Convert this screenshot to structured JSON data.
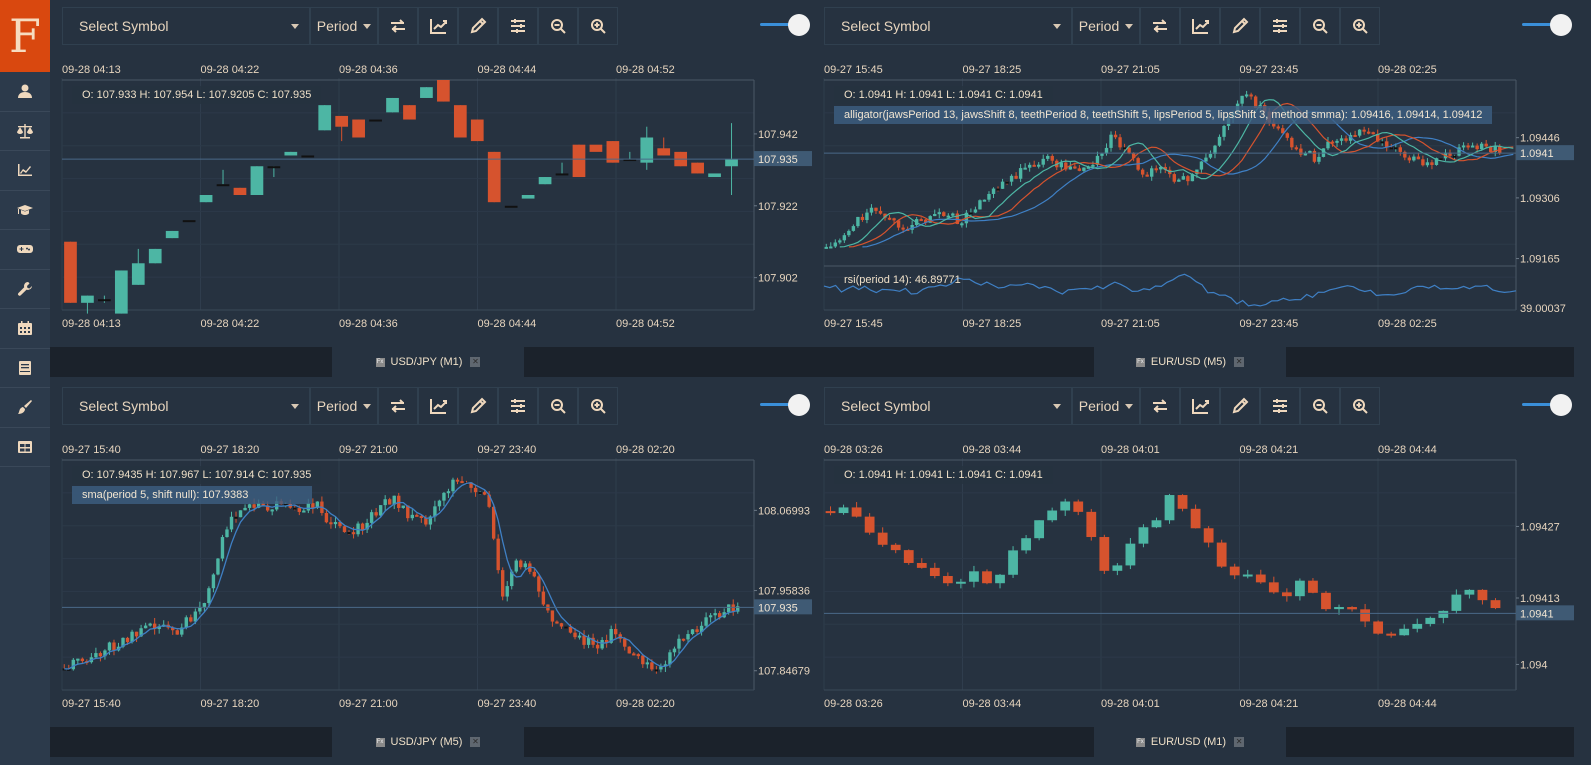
{
  "app": {
    "logo_letter": "F"
  },
  "sidebar": {
    "items": [
      {
        "name": "account",
        "icon": "user-icon"
      },
      {
        "name": "balance",
        "icon": "scale-icon"
      },
      {
        "name": "charts",
        "icon": "chart-line-icon"
      },
      {
        "name": "education",
        "icon": "graduation-cap-icon"
      },
      {
        "name": "games",
        "icon": "gamepad-icon"
      },
      {
        "name": "tools",
        "icon": "wrench-icon"
      },
      {
        "name": "calendar",
        "icon": "calendar-icon"
      },
      {
        "name": "book",
        "icon": "book-icon"
      },
      {
        "name": "themes",
        "icon": "paint-brush-icon"
      },
      {
        "name": "layout",
        "icon": "table-icon"
      }
    ]
  },
  "toolbar": {
    "symbol_placeholder": "Select Symbol",
    "period_label": "Period",
    "icons": [
      "swap-icon",
      "indicator-chart-icon",
      "pencil-icon",
      "settings-sliders-icon",
      "zoom-out-icon",
      "zoom-in-icon"
    ]
  },
  "colors": {
    "up": "#4db6a4",
    "down": "#d6532e",
    "sma": "#3f80c5",
    "jaws": "#3f80c5",
    "teeth": "#d6532e",
    "lips": "#4db6a4",
    "rsi": "#3f80c5",
    "accent": "#3a8fd9",
    "logo_bg": "#d9480f"
  },
  "panels": [
    {
      "tab": "USD/JPY (M1)",
      "ohlc": "O: 107.933 H: 107.954 L: 107.9205 C: 107.935",
      "indicator": null,
      "rsi": null,
      "current_price": "107.935",
      "time_labels": [
        "09-28 04:13",
        "09-28 04:22",
        "09-28 04:36",
        "09-28 04:44",
        "09-28 04:52"
      ],
      "price_labels": [
        "107.942",
        "107.922",
        "107.902"
      ],
      "chart_data": {
        "type": "candlestick",
        "symbol": "USD/JPY",
        "period": "M1",
        "x_ticks": [
          "09-28 04:13",
          "09-28 04:22",
          "09-28 04:36",
          "09-28 04:44",
          "09-28 04:52"
        ],
        "y_ticks": [
          107.942,
          107.922,
          107.902
        ],
        "ylim": [
          107.893,
          107.957
        ],
        "last_close": 107.935,
        "candles": [
          [
            107.912,
            107.912,
            107.895,
            107.895
          ],
          [
            107.895,
            107.897,
            107.892,
            107.897
          ],
          [
            107.896,
            107.897,
            107.895,
            107.896
          ],
          [
            107.892,
            107.904,
            107.892,
            107.904
          ],
          [
            107.9,
            107.91,
            107.9,
            107.906
          ],
          [
            107.906,
            107.91,
            107.906,
            107.91
          ],
          [
            107.913,
            107.915,
            107.913,
            107.915
          ],
          [
            107.918,
            107.918,
            107.918,
            107.918
          ],
          [
            107.923,
            107.925,
            107.923,
            107.925
          ],
          [
            107.928,
            107.932,
            107.928,
            107.928
          ],
          [
            107.927,
            107.927,
            107.925,
            107.925
          ],
          [
            107.925,
            107.933,
            107.925,
            107.933
          ],
          [
            107.933,
            107.933,
            107.93,
            107.933
          ],
          [
            107.936,
            107.937,
            107.936,
            107.937
          ],
          [
            107.936,
            107.936,
            107.936,
            107.936
          ],
          [
            107.943,
            107.95,
            107.943,
            107.95
          ],
          [
            107.947,
            107.947,
            107.94,
            107.944
          ],
          [
            107.946,
            107.946,
            107.941,
            107.941
          ],
          [
            107.946,
            107.946,
            107.946,
            107.946
          ],
          [
            107.948,
            107.952,
            107.948,
            107.952
          ],
          [
            107.95,
            107.95,
            107.946,
            107.946
          ],
          [
            107.952,
            107.955,
            107.952,
            107.955
          ],
          [
            107.957,
            107.957,
            107.951,
            107.951
          ],
          [
            107.95,
            107.95,
            107.941,
            107.941
          ],
          [
            107.946,
            107.946,
            107.94,
            107.94
          ],
          [
            107.937,
            107.937,
            107.923,
            107.923
          ],
          [
            107.922,
            107.922,
            107.922,
            107.922
          ],
          [
            107.924,
            107.924,
            107.924,
            107.925
          ],
          [
            107.928,
            107.93,
            107.928,
            107.93
          ],
          [
            107.931,
            107.934,
            107.931,
            107.931
          ],
          [
            107.939,
            107.939,
            107.93,
            107.93
          ],
          [
            107.939,
            107.937,
            107.937,
            107.937
          ],
          [
            107.94,
            107.94,
            107.934,
            107.934
          ],
          [
            107.935,
            107.937,
            107.935,
            107.935
          ],
          [
            107.934,
            107.944,
            107.932,
            107.941
          ],
          [
            107.938,
            107.941,
            107.936,
            107.936
          ],
          [
            107.937,
            107.937,
            107.933,
            107.933
          ],
          [
            107.934,
            107.934,
            107.931,
            107.931
          ],
          [
            107.93,
            107.93,
            107.93,
            107.931
          ],
          [
            107.933,
            107.945,
            107.925,
            107.935
          ]
        ]
      }
    },
    {
      "tab": "EUR/USD (M5)",
      "ohlc": "O: 1.0941 H: 1.0941 L: 1.0941 C: 1.0941",
      "indicator": "alligator(jawsPeriod 13, jawsShift 8, teethPeriod 8, teethShift 5, lipsPeriod 5, lipsShift 3, method smma): 1.09416, 1.09414, 1.09412",
      "rsi": "rsi(period 14): 46.89771",
      "rsi_axis_label": "39.00037",
      "current_price": "1.0941",
      "time_labels": [
        "09-27 15:45",
        "09-27 18:25",
        "09-27 21:05",
        "09-27 23:45",
        "09-28 02:25"
      ],
      "price_labels": [
        "1.09446",
        "1.09306",
        "1.09165"
      ],
      "chart_data": {
        "type": "candlestick",
        "symbol": "EUR/USD",
        "period": "M5",
        "x_ticks": [
          "09-27 15:45",
          "09-27 18:25",
          "09-27 21:05",
          "09-27 23:45",
          "09-28 02:25"
        ],
        "y_ticks": [
          1.09446,
          1.09306,
          1.09165
        ],
        "ylim": [
          1.0915,
          1.0958
        ],
        "last_close": 1.0941,
        "indicators": [
          {
            "name": "alligator",
            "params": "jawsPeriod 13, jawsShift 8, teethPeriod 8, teethShift 5, lipsPeriod 5, lipsShift 3, method smma",
            "values": [
              1.09416,
              1.09414,
              1.09412
            ]
          },
          {
            "name": "rsi",
            "params": "period 14",
            "value": 46.89771,
            "axis_label": 39.00037
          }
        ],
        "path": [
          1.0919,
          1.0921,
          1.0926,
          1.0928,
          1.0925,
          1.0924,
          1.0926,
          1.0927,
          1.0925,
          1.0929,
          1.0932,
          1.0935,
          1.0938,
          1.094,
          1.0938,
          1.0937,
          1.0939,
          1.0945,
          1.094,
          1.0936,
          1.0938,
          1.0934,
          1.0937,
          1.0942,
          1.095,
          1.0955,
          1.095,
          1.0946,
          1.0942,
          1.094,
          1.0944,
          1.0945,
          1.0946,
          1.0943,
          1.0941,
          1.0939,
          1.0939,
          1.0941,
          1.0942,
          1.0943,
          1.0941
        ],
        "rsi_path": [
          52,
          48,
          50,
          47,
          49,
          46,
          48,
          50,
          55,
          52,
          50,
          49,
          51,
          48,
          46,
          50,
          49,
          52,
          48,
          47,
          55,
          60,
          48,
          43,
          40,
          38,
          42,
          39,
          44,
          47,
          52,
          49,
          45,
          44,
          48,
          51,
          47,
          49,
          52,
          48,
          47
        ]
      }
    },
    {
      "tab": "USD/JPY (M5)",
      "ohlc": "O: 107.9435 H: 107.967 L: 107.914 C: 107.935",
      "indicator": "sma(period 5, shift null): 107.9383",
      "rsi": null,
      "current_price": "107.935",
      "time_labels": [
        "09-27 15:40",
        "09-27 18:20",
        "09-27 21:00",
        "09-27 23:40",
        "09-28 02:20"
      ],
      "price_labels": [
        "108.06993",
        "107.95836",
        "107.84679"
      ],
      "chart_data": {
        "type": "candlestick",
        "symbol": "USD/JPY",
        "period": "M5",
        "x_ticks": [
          "09-27 15:40",
          "09-27 18:20",
          "09-27 21:00",
          "09-27 23:40",
          "09-28 02:20"
        ],
        "y_ticks": [
          108.06993,
          107.95836,
          107.84679
        ],
        "ylim": [
          107.82,
          108.14
        ],
        "last_close": 107.935,
        "indicators": [
          {
            "name": "sma",
            "params": "period 5, shift null",
            "value": 107.9383
          }
        ],
        "path": [
          107.85,
          107.86,
          107.87,
          107.88,
          107.89,
          107.9,
          107.91,
          107.9,
          107.92,
          107.95,
          108.02,
          108.07,
          108.08,
          108.07,
          108.08,
          108.07,
          108.08,
          108.05,
          108.04,
          108.05,
          108.07,
          108.09,
          108.06,
          108.05,
          108.08,
          108.12,
          108.1,
          108.09,
          107.95,
          108.0,
          107.98,
          107.92,
          107.91,
          107.89,
          107.88,
          107.9,
          107.88,
          107.86,
          107.85,
          107.88,
          107.9,
          107.92,
          107.93,
          107.935
        ]
      }
    },
    {
      "tab": "EUR/USD (M1)",
      "ohlc": "O: 1.0941 H: 1.0941 L: 1.0941 C: 1.0941",
      "indicator": null,
      "rsi": null,
      "current_price": "1.0941",
      "time_labels": [
        "09-28 03:26",
        "09-28 03:44",
        "09-28 04:01",
        "09-28 04:21",
        "09-28 04:44"
      ],
      "price_labels": [
        "1.09427",
        "1.09413",
        "1.094"
      ],
      "chart_data": {
        "type": "candlestick",
        "symbol": "EUR/USD",
        "period": "M1",
        "x_ticks": [
          "09-28 03:26",
          "09-28 03:44",
          "09-28 04:01",
          "09-28 04:21",
          "09-28 04:44"
        ],
        "y_ticks": [
          1.09427,
          1.09413,
          1.094
        ],
        "ylim": [
          1.09395,
          1.0944
        ],
        "last_close": 1.0941,
        "path": [
          1.0943,
          1.09432,
          1.09428,
          1.09425,
          1.09422,
          1.0942,
          1.09419,
          1.09417,
          1.09415,
          1.09418,
          1.09416,
          1.0942,
          1.09425,
          1.09428,
          1.0943,
          1.09432,
          1.09425,
          1.09418,
          1.0942,
          1.09426,
          1.09428,
          1.09434,
          1.0943,
          1.09425,
          1.0942,
          1.09418,
          1.09416,
          1.09414,
          1.09413,
          1.09416,
          1.09412,
          1.0941,
          1.09412,
          1.09409,
          1.09406,
          1.09405,
          1.09408,
          1.09409,
          1.0941,
          1.09416,
          1.09414,
          1.0941
        ]
      }
    }
  ]
}
